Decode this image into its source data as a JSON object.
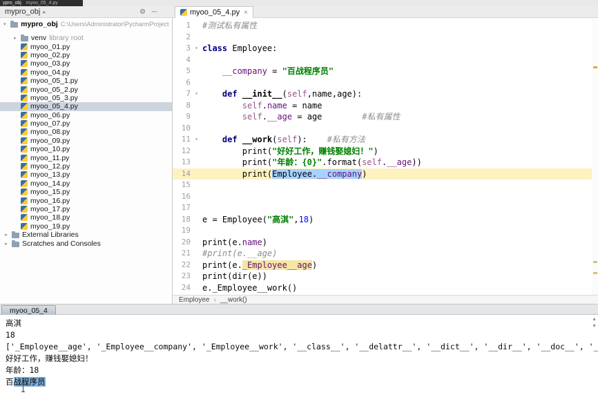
{
  "titlebar": {
    "app_label": "ypro_obj",
    "tab_label": "myoo_05_4.py"
  },
  "navbar": {
    "project": "mypro_obj"
  },
  "icons": {
    "gear": "⚙",
    "hide": "─",
    "collapse_arrow": "▾",
    "expand_arrow": "▸",
    "crumb_sep": "›",
    "close": "×",
    "scroll_up": "▲",
    "scroll_down": "▼"
  },
  "panel_icons": [
    {
      "name": "settings-gear-icon",
      "glyph": "⚙"
    },
    {
      "name": "hide-panel-icon",
      "glyph": "─"
    }
  ],
  "editor_tab": {
    "label": "myoo_05_4.py",
    "close_glyph": "×"
  },
  "project_panel": {
    "root_name": "mypro_obj",
    "root_path": "C:\\Users\\Administrator\\PycharmProjects\\mypro_obj",
    "root_arrow": "▾",
    "items": [
      {
        "label": "venv",
        "note": "library root",
        "icon": "folder",
        "indent": 1,
        "arrow": true
      },
      {
        "label": "myoo_01.py",
        "icon": "python",
        "indent": 1
      },
      {
        "label": "myoo_02.py",
        "icon": "python",
        "indent": 1
      },
      {
        "label": "myoo_03.py",
        "icon": "python",
        "indent": 1
      },
      {
        "label": "myoo_04.py",
        "icon": "python",
        "indent": 1
      },
      {
        "label": "myoo_05_1.py",
        "icon": "python",
        "indent": 1
      },
      {
        "label": "myoo_05_2.py",
        "icon": "python",
        "indent": 1
      },
      {
        "label": "myoo_05_3.py",
        "icon": "python",
        "indent": 1
      },
      {
        "label": "myoo_05_4.py",
        "icon": "python",
        "indent": 1,
        "selected": true
      },
      {
        "label": "myoo_06.py",
        "icon": "python",
        "indent": 1
      },
      {
        "label": "myoo_07.py",
        "icon": "python",
        "indent": 1
      },
      {
        "label": "myoo_08.py",
        "icon": "python",
        "indent": 1
      },
      {
        "label": "myoo_09.py",
        "icon": "python",
        "indent": 1
      },
      {
        "label": "myoo_10.py",
        "icon": "python",
        "indent": 1
      },
      {
        "label": "myoo_11.py",
        "icon": "python",
        "indent": 1
      },
      {
        "label": "myoo_12.py",
        "icon": "python",
        "indent": 1
      },
      {
        "label": "myoo_13.py",
        "icon": "python",
        "indent": 1
      },
      {
        "label": "myoo_14.py",
        "icon": "python",
        "indent": 1
      },
      {
        "label": "myoo_15.py",
        "icon": "python",
        "indent": 1
      },
      {
        "label": "myoo_16.py",
        "icon": "python",
        "indent": 1
      },
      {
        "label": "myoo_17.py",
        "icon": "python",
        "indent": 1
      },
      {
        "label": "myoo_18.py",
        "icon": "python",
        "indent": 1
      },
      {
        "label": "myoo_19.py",
        "icon": "python",
        "indent": 1
      },
      {
        "label": "External Libraries",
        "icon": "folder",
        "indent": 0,
        "arrow": true
      },
      {
        "label": "Scratches and Consoles",
        "icon": "folder",
        "indent": 0,
        "arrow": true
      }
    ]
  },
  "editor": {
    "current_line": 14,
    "folds": [
      3,
      7,
      11
    ],
    "breadcrumbs": [
      "Employee",
      "__work()"
    ],
    "lines": [
      {
        "n": 1,
        "segs": [
          {
            "t": "#测试私有属性",
            "c": "com"
          }
        ]
      },
      {
        "n": 2,
        "segs": []
      },
      {
        "n": 3,
        "segs": [
          {
            "t": "class",
            "c": "kw"
          },
          {
            "t": " Employee:",
            "c": "pl"
          }
        ]
      },
      {
        "n": 4,
        "segs": []
      },
      {
        "n": 5,
        "segs": [
          {
            "t": "    ",
            "c": "pl"
          },
          {
            "t": "__company",
            "c": "field"
          },
          {
            "t": " = ",
            "c": "pl"
          },
          {
            "t": "\"百战程序员\"",
            "c": "str"
          }
        ]
      },
      {
        "n": 6,
        "segs": []
      },
      {
        "n": 7,
        "segs": [
          {
            "t": "    ",
            "c": "pl"
          },
          {
            "t": "def ",
            "c": "kw"
          },
          {
            "t": "__init__",
            "c": "fn"
          },
          {
            "t": "(",
            "c": "pl"
          },
          {
            "t": "self",
            "c": "self"
          },
          {
            "t": ",name,age):",
            "c": "pl"
          }
        ]
      },
      {
        "n": 8,
        "segs": [
          {
            "t": "        ",
            "c": "pl"
          },
          {
            "t": "self",
            "c": "self"
          },
          {
            "t": ".",
            "c": "pl"
          },
          {
            "t": "name",
            "c": "field"
          },
          {
            "t": " = name",
            "c": "pl"
          }
        ]
      },
      {
        "n": 9,
        "segs": [
          {
            "t": "        ",
            "c": "pl"
          },
          {
            "t": "self",
            "c": "self"
          },
          {
            "t": ".",
            "c": "pl"
          },
          {
            "t": "__age",
            "c": "field"
          },
          {
            "t": " = age",
            "c": "pl"
          },
          {
            "t": "        ",
            "c": "pl"
          },
          {
            "t": "#私有属性",
            "c": "com"
          }
        ]
      },
      {
        "n": 10,
        "segs": []
      },
      {
        "n": 11,
        "segs": [
          {
            "t": "    ",
            "c": "pl"
          },
          {
            "t": "def ",
            "c": "kw"
          },
          {
            "t": "__work",
            "c": "fn"
          },
          {
            "t": "(",
            "c": "pl"
          },
          {
            "t": "self",
            "c": "self"
          },
          {
            "t": "):",
            "c": "pl"
          },
          {
            "t": "    ",
            "c": "pl"
          },
          {
            "t": "#私有方法",
            "c": "com"
          }
        ]
      },
      {
        "n": 12,
        "segs": [
          {
            "t": "        print(",
            "c": "pl"
          },
          {
            "t": "\"好好工作，赚钱娶媳妇！\"",
            "c": "str"
          },
          {
            "t": ")",
            "c": "pl"
          }
        ]
      },
      {
        "n": 13,
        "segs": [
          {
            "t": "        print(",
            "c": "pl"
          },
          {
            "t": "\"年龄：{0}\"",
            "c": "str"
          },
          {
            "t": ".format(",
            "c": "pl"
          },
          {
            "t": "self",
            "c": "self"
          },
          {
            "t": ".",
            "c": "pl"
          },
          {
            "t": "__age",
            "c": "field"
          },
          {
            "t": "))",
            "c": "pl"
          }
        ]
      },
      {
        "n": 14,
        "segs": [
          {
            "t": "        print(",
            "c": "pl"
          },
          {
            "t": "Employee.",
            "c": "sel"
          },
          {
            "t": "__company",
            "c": "selfield"
          },
          {
            "t": ")",
            "c": "pl"
          }
        ]
      },
      {
        "n": 15,
        "segs": []
      },
      {
        "n": 16,
        "segs": []
      },
      {
        "n": 17,
        "segs": []
      },
      {
        "n": 18,
        "segs": [
          {
            "t": "e = Employee(",
            "c": "pl"
          },
          {
            "t": "\"高淇\"",
            "c": "str"
          },
          {
            "t": ",",
            "c": "pl"
          },
          {
            "t": "18",
            "c": "num"
          },
          {
            "t": ")",
            "c": "pl"
          }
        ]
      },
      {
        "n": 19,
        "segs": []
      },
      {
        "n": 20,
        "segs": [
          {
            "t": "print(e.",
            "c": "pl"
          },
          {
            "t": "name",
            "c": "field"
          },
          {
            "t": ")",
            "c": "pl"
          }
        ]
      },
      {
        "n": 21,
        "segs": [
          {
            "t": "#print(e.__age)",
            "c": "com"
          }
        ]
      },
      {
        "n": 22,
        "segs": [
          {
            "t": "print(e.",
            "c": "pl"
          },
          {
            "t": "_Employee__age",
            "c": "hl"
          },
          {
            "t": ")",
            "c": "pl"
          }
        ]
      },
      {
        "n": 23,
        "segs": [
          {
            "t": "print(dir(e))",
            "c": "pl"
          }
        ]
      },
      {
        "n": 24,
        "segs": [
          {
            "t": "e._Employee__work()",
            "c": "pl"
          }
        ]
      }
    ]
  },
  "console": {
    "tab": "myoo_05_4",
    "lines": [
      {
        "segs": [
          {
            "t": "高淇",
            "c": "out"
          }
        ]
      },
      {
        "segs": [
          {
            "t": "18",
            "c": "out"
          }
        ]
      },
      {
        "segs": [
          {
            "t": "['_Employee__age', '_Employee__company', '_Employee__work', '__class__', '__delattr__', '__dict__', '__dir__', '__doc__', '__eq__', '__format__', '__g",
            "c": "out"
          }
        ]
      },
      {
        "segs": [
          {
            "t": "好好工作，赚钱娶媳妇！",
            "c": "out"
          }
        ]
      },
      {
        "segs": [
          {
            "t": "年龄：18",
            "c": "out"
          }
        ]
      },
      {
        "segs": [
          {
            "t": "百",
            "c": "out"
          },
          {
            "t": "战程序员",
            "c": "csel"
          }
        ]
      }
    ]
  },
  "colors": {
    "selection_blue": "#a6d2ff",
    "current_line_yellow": "#fdf2c0",
    "usage_highlight_yellow": "#f5e6a3",
    "console_selection_blue": "#7eb0de",
    "stripe_orange": "#e8a33d"
  }
}
